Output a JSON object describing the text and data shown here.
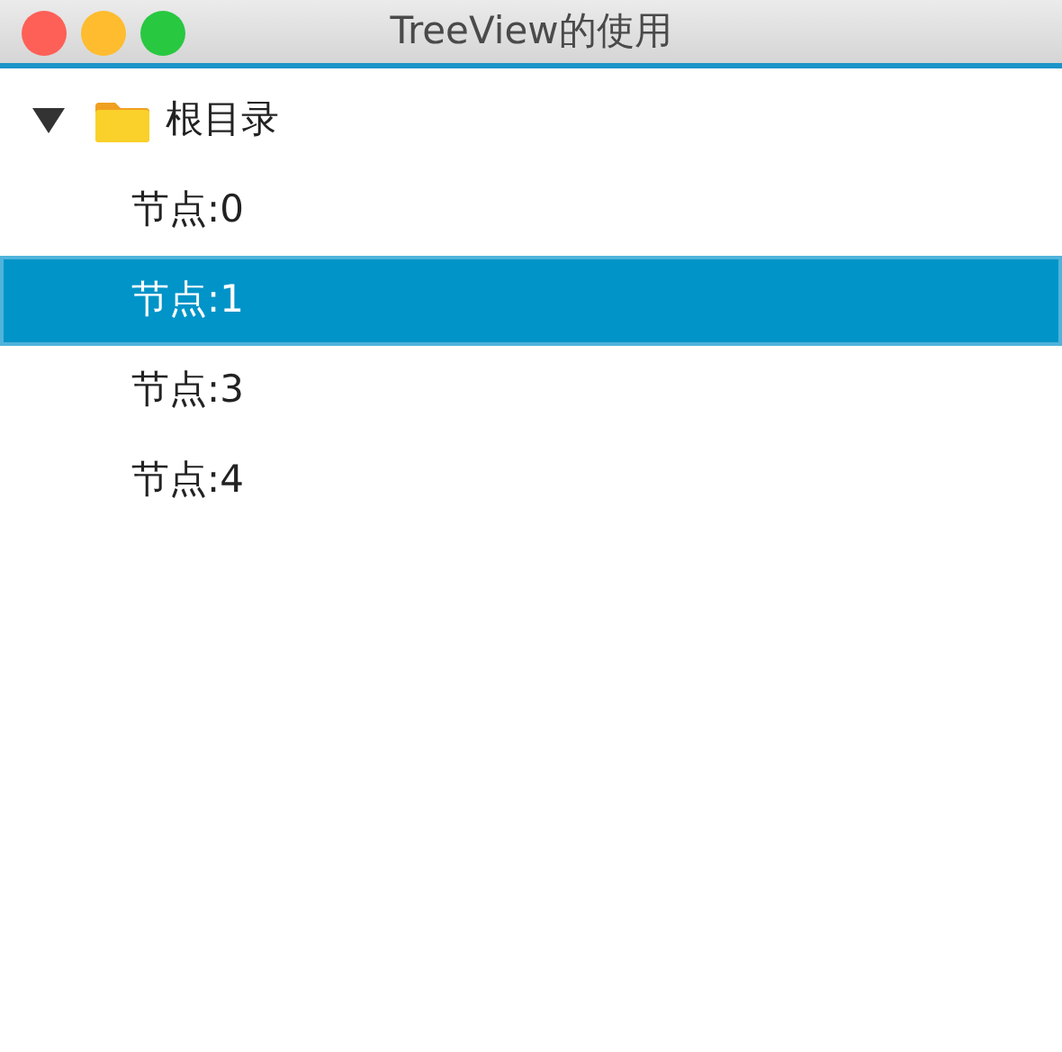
{
  "window": {
    "title": "TreeView的使用"
  },
  "tree": [
    {
      "label": "根目录",
      "expanded": true,
      "selected": false,
      "children": [
        {
          "label": "节点:0",
          "selected": false
        },
        {
          "label": "节点:1",
          "selected": true
        },
        {
          "label": "节点:3",
          "selected": false
        },
        {
          "label": "节点:4",
          "selected": false
        }
      ]
    }
  ]
}
